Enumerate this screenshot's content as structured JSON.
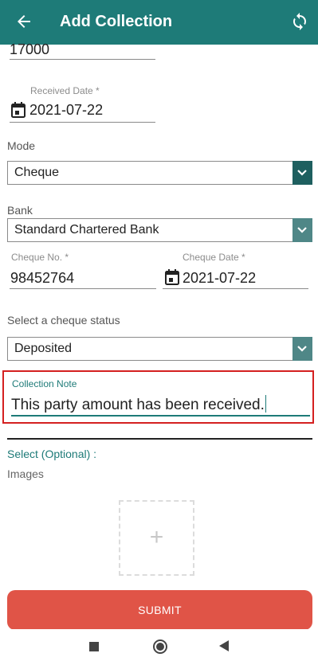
{
  "appbar": {
    "title": "Add Collection",
    "back_icon": "arrow-left-icon",
    "sync_icon": "sync-icon"
  },
  "amount": {
    "value": "17000"
  },
  "received_date": {
    "label": "Received Date *",
    "value": "2021-07-22",
    "icon": "calendar-icon"
  },
  "mode": {
    "label": "Mode",
    "selected": "Cheque"
  },
  "bank": {
    "label": "Bank",
    "selected": "Standard Chartered Bank"
  },
  "cheque_no": {
    "label": "Cheque No. *",
    "value": "98452764"
  },
  "cheque_date": {
    "label": "Cheque Date *",
    "value": "2021-07-22",
    "icon": "calendar-icon"
  },
  "cheque_status": {
    "label": "Select a cheque status",
    "selected": "Deposited"
  },
  "collection_note": {
    "label": "Collection Note",
    "value": "This party amount has been received."
  },
  "attachments": {
    "select_label": "Select (Optional) :",
    "images_label": "Images",
    "add_symbol": "+"
  },
  "submit": {
    "label": "SUBMIT"
  },
  "colors": {
    "primary": "#1e7b78",
    "submit": "#e05447",
    "highlight_border": "#d42020"
  },
  "navbar": {
    "recents_icon": "square-icon",
    "home_icon": "circle-icon",
    "back_icon": "triangle-back-icon"
  }
}
